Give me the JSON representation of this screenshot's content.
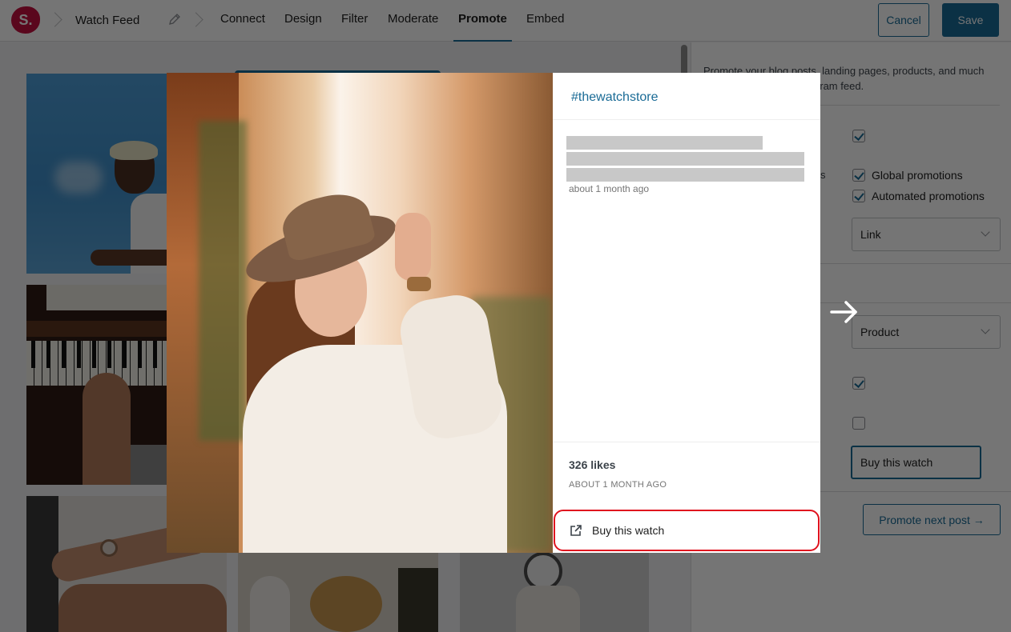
{
  "app": {
    "logo_text": "S.",
    "feed_name": "Watch Feed",
    "edit_icon": "pencil-icon"
  },
  "tabs": [
    {
      "label": "Connect",
      "active": false
    },
    {
      "label": "Design",
      "active": false
    },
    {
      "label": "Filter",
      "active": false
    },
    {
      "label": "Moderate",
      "active": false
    },
    {
      "label": "Promote",
      "active": true
    },
    {
      "label": "Embed",
      "active": false
    }
  ],
  "toolbar": {
    "cancel_label": "Cancel",
    "save_label": "Save"
  },
  "sidebar": {
    "intro": "Promote your blog posts, landing pages, products, and much more through your Instagram feed.",
    "label_fragment": "s",
    "enable_checked": true,
    "global_promotions": {
      "label": "Global promotions",
      "checked": true
    },
    "automated_promotions": {
      "label": "Automated promotions",
      "checked": true
    },
    "link_type_select": "Link",
    "promotion_type_select": "Product",
    "checkbox_a_checked": true,
    "checkbox_b_checked": false,
    "button_text_value": "Buy this watch",
    "promote_next_label": "Promote next post →"
  },
  "modal": {
    "account": "#thewatchstore",
    "caption_time": "about 1 month ago",
    "likes": "326 likes",
    "date": "ABOUT 1 MONTH AGO",
    "cta_label": "Buy this watch",
    "cta_icon": "external-link-icon"
  },
  "colors": {
    "accent": "#1a6b96",
    "brand": "#c4113f",
    "highlight": "#e0131e"
  }
}
